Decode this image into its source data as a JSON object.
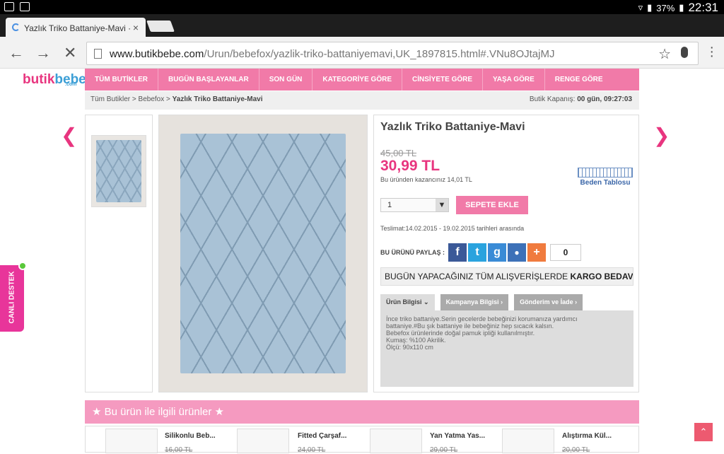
{
  "status": {
    "battery": "37%",
    "time": "22:31"
  },
  "tab": {
    "title": "Yazlık Triko Battaniye-Mavi ·",
    "close": "×"
  },
  "url": {
    "host": "www.butikbebe.com",
    "path": "/Urun/bebefox/yazlik-triko-battaniyemavi,UK_1897815.html#.VNu8OJtajMJ"
  },
  "logo": {
    "a": "butik",
    "b": "bebe",
    "c": ".com"
  },
  "nav": [
    "TÜM BUTİKLER",
    "BUGÜN BAŞLAYANLAR",
    "SON GÜN",
    "KATEGORİYE GÖRE",
    "CİNSİYETE GÖRE",
    "YAŞA GÖRE",
    "RENGE GÖRE"
  ],
  "crumbs": {
    "c1": "Tüm Butikler",
    "sep": ">",
    "c2": "Bebefox",
    "c3": "Yazlık Triko Battaniye-Mavi",
    "timer_label": "Butik Kapanış:",
    "timer_value": "00 gün, 09:27:03"
  },
  "product": {
    "title": "Yazlık Triko Battaniye-Mavi",
    "old_price": "45,00 TL",
    "price": "30,99 TL",
    "saving": "Bu üründen kazancınız 14,01 TL",
    "size_chart": "Beden Tablosu",
    "qty": "1",
    "add_to_cart": "SEPETE EKLE",
    "shipping": "Teslimat:14.02.2015 - 19.02.2015 tarihleri arasında",
    "share_label": "BU ÜRÜNÜ PAYLAŞ :",
    "share_count": "0",
    "cargo_text": "BUGÜN YAPACAĞINIZ TÜM ALIŞVERİŞLERDE ",
    "cargo_bold": "KARGO BEDAVA!",
    "tabs": [
      "Ürün Bilgisi",
      "Kampanya Bilgisi",
      "Gönderim ve İade"
    ],
    "desc": [
      "İnce triko battaniye.Serin gecelerde bebeğinizi korumanıza yardımcı",
      "battaniye.#Bu şık battaniye ile bebeğiniz hep sıcacık kalsın.",
      "Bebefox ürünlerinde doğal pamuk ipliği kullanılmıştır.",
      "Kumaş: %100 Akrilik.",
      "Ölçü: 90x110 cm"
    ]
  },
  "related": {
    "title": "Bu ürün ile ilgili ürünler",
    "items": [
      {
        "name": "Silikonlu Beb...",
        "old": "16,00 TL"
      },
      {
        "name": "Fitted Çarşaf...",
        "old": "24,00 TL"
      },
      {
        "name": "Yan Yatma Yas...",
        "old": "29,00 TL"
      },
      {
        "name": "Alıştırma Kül...",
        "old": "20,00 TL"
      }
    ]
  },
  "support": "CANLI DESTEK",
  "colors": {
    "pink": "#f17aa8",
    "accent": "#e8357f",
    "facebook": "#3b5998",
    "twitter": "#2aa3de",
    "google": "#3a8bd6",
    "more": "#f07b3e"
  }
}
